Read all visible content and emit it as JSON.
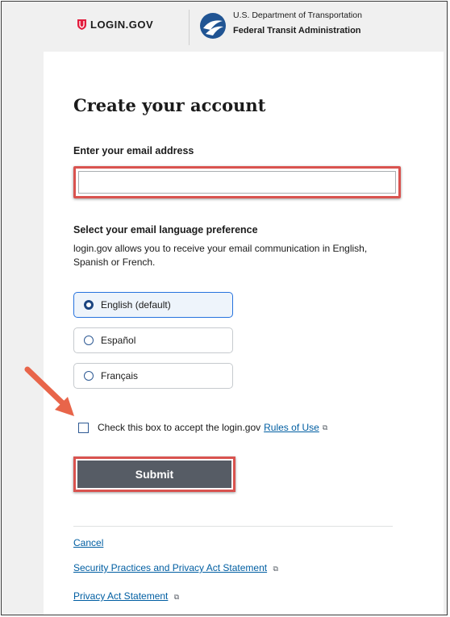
{
  "header": {
    "logo_text": "LOGIN.GOV",
    "agency_line1": "U.S. Department of Transportation",
    "agency_line2": "Federal Transit Administration"
  },
  "form": {
    "title": "Create your account",
    "email_label": "Enter your email address",
    "email_value": "",
    "language_title": "Select your email language preference",
    "language_description": "login.gov allows you to receive your email communication in English, Spanish or French.",
    "language_options": [
      {
        "label": "English (default)",
        "selected": true
      },
      {
        "label": "Español",
        "selected": false
      },
      {
        "label": "Français",
        "selected": false
      }
    ],
    "terms_text": "Check this box to accept the login.gov",
    "terms_link": "Rules of Use",
    "terms_checked": false,
    "submit_label": "Submit"
  },
  "footer": {
    "cancel": "Cancel",
    "security_link": "Security Practices and Privacy Act Statement",
    "privacy_link": "Privacy Act Statement"
  },
  "colors": {
    "highlight": "#d9534f",
    "arrow": "#e8654a",
    "link": "#005ea2",
    "submit_bg": "#565c65",
    "logo_red": "#e21c3d",
    "agency_blue": "#205493"
  },
  "icons": {
    "logo": "shield-icon",
    "agency": "dot-logo-icon",
    "external": "external-link-icon",
    "annotation": "arrow-icon"
  }
}
